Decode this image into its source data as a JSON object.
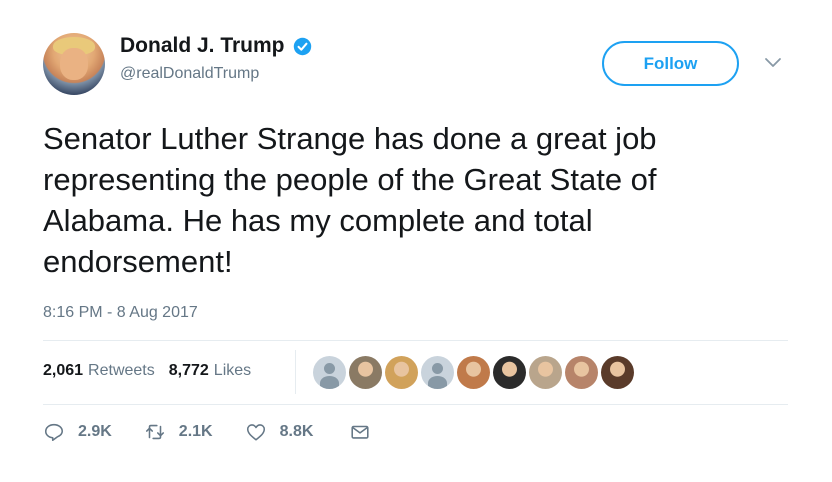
{
  "author": {
    "name": "Donald J. Trump",
    "handle": "@realDonaldTrump",
    "verified": true
  },
  "follow_label": "Follow",
  "tweet": {
    "text": "Senator Luther Strange has done a great job\nrepresenting the people of the Great State of\nAlabama. He has my complete and total\nendorsement!",
    "timestamp": "8:16 PM - 8 Aug 2017"
  },
  "stats": {
    "retweets_count": "2,061",
    "retweets_label": "Retweets",
    "likes_count": "8,772",
    "likes_label": "Likes"
  },
  "likers": [
    {
      "type": "default"
    },
    {
      "type": "photo",
      "color": "#8a7a64"
    },
    {
      "type": "photo",
      "color": "#d1a25b"
    },
    {
      "type": "default"
    },
    {
      "type": "photo",
      "color": "#c07a4a"
    },
    {
      "type": "photo",
      "color": "#2b2b2b"
    },
    {
      "type": "photo",
      "color": "#b9a58c"
    },
    {
      "type": "photo",
      "color": "#b7846a"
    },
    {
      "type": "photo",
      "color": "#5a3b2a"
    }
  ],
  "actions": {
    "reply_count": "2.9K",
    "retweet_count": "2.1K",
    "like_count": "8.8K"
  },
  "colors": {
    "accent": "#1da1f2",
    "secondary_text": "#657786",
    "divider": "#e6ecf0"
  }
}
